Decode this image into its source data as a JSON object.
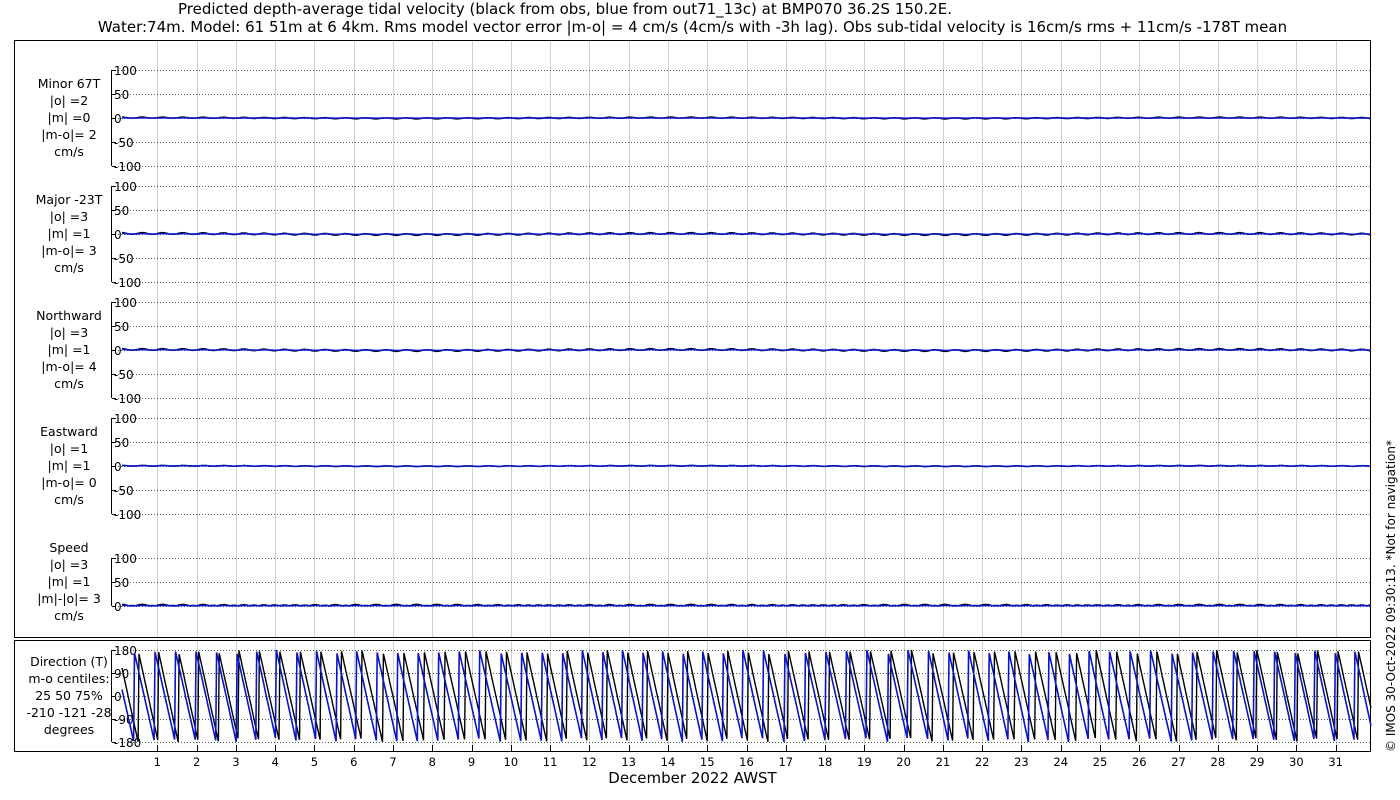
{
  "header": {
    "title_line1": "Predicted depth-average tidal velocity (black from obs, blue from out71_13c) at BMP070 36.2S 150.2E.",
    "title_line2": "Water:74m. Model: 61 51m at 6 4km. Rms model vector error |m-o| = 4 cm/s (4cm/s with -3h lag). Obs sub-tidal velocity is 16cm/s rms + 11cm/s -178T mean"
  },
  "copyright": "© IMOS 30-Oct-2022 09:30:13. *Not for navigation*",
  "panels": [
    {
      "lines": [
        "Minor 67T",
        "|o| =2",
        "|m| =0",
        "|m-o|= 2",
        "cm/s"
      ]
    },
    {
      "lines": [
        "Major -23T",
        "|o| =3",
        "|m| =1",
        "|m-o|= 3",
        "cm/s"
      ]
    },
    {
      "lines": [
        "Northward",
        "|o| =3",
        "|m| =1",
        "|m-o|= 4",
        "cm/s"
      ]
    },
    {
      "lines": [
        "Eastward",
        "|o| =1",
        "|m| =1",
        "|m-o|= 0",
        "cm/s"
      ]
    },
    {
      "lines": [
        "Speed",
        "|o| =3",
        "|m| =1",
        "|m|-|o|= 3",
        "cm/s"
      ]
    },
    {
      "lines": [
        "Direction (T)",
        "m-o centiles:",
        "25  50  75%",
        "-210 -121  -28",
        "degrees"
      ]
    }
  ],
  "chart_data": {
    "type": "line",
    "xlabel": "December 2022 AWST",
    "x_ticks": [
      1,
      2,
      3,
      4,
      5,
      6,
      7,
      8,
      9,
      10,
      11,
      12,
      13,
      14,
      15,
      16,
      17,
      18,
      19,
      20,
      21,
      22,
      23,
      24,
      25,
      26,
      27,
      28,
      29,
      30,
      31
    ],
    "xlim": [
      0.1,
      31.9
    ],
    "series_colors": {
      "obs": "#000000",
      "model": "#0a14c8"
    },
    "subplots": [
      {
        "id": "minor",
        "ylim": [
          -100,
          100
        ],
        "yticks": [
          100,
          50,
          0,
          -50,
          -100
        ],
        "obs_amplitude": 2,
        "model_amplitude": 0.5
      },
      {
        "id": "major",
        "ylim": [
          -100,
          100
        ],
        "yticks": [
          100,
          50,
          0,
          -50,
          -100
        ],
        "obs_amplitude": 3,
        "model_amplitude": 1
      },
      {
        "id": "northward",
        "ylim": [
          -100,
          100
        ],
        "yticks": [
          100,
          50,
          0,
          -50,
          -100
        ],
        "obs_amplitude": 3,
        "model_amplitude": 1
      },
      {
        "id": "eastward",
        "ylim": [
          -100,
          100
        ],
        "yticks": [
          100,
          50,
          0,
          -50,
          -100
        ],
        "obs_amplitude": 1,
        "model_amplitude": 1
      },
      {
        "id": "speed",
        "ylim": [
          0,
          100
        ],
        "yticks": [
          100,
          50,
          0
        ],
        "obs_amplitude": 3,
        "model_amplitude": 1
      },
      {
        "id": "direction",
        "ylim": [
          -180,
          180
        ],
        "yticks": [
          180,
          90,
          0,
          -90,
          -180
        ],
        "obs_cycles_per_day": 1.93,
        "model_cycles_per_day": 1.93,
        "model_lag_days": -0.125
      }
    ]
  }
}
